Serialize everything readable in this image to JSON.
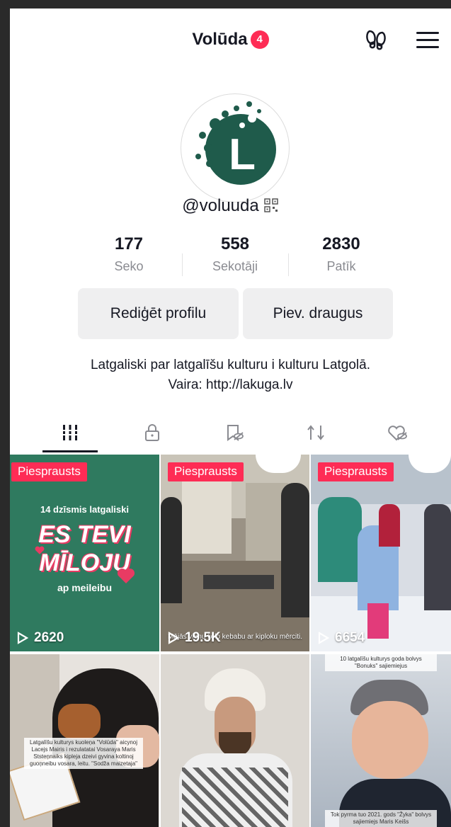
{
  "header": {
    "title": "Volūda",
    "badge": "4"
  },
  "profile": {
    "handle": "@voluuda",
    "avatar_letter": "L"
  },
  "stats": [
    {
      "value": "177",
      "label": "Seko"
    },
    {
      "value": "558",
      "label": "Sekotāji"
    },
    {
      "value": "2830",
      "label": "Patīk"
    }
  ],
  "buttons": {
    "edit": "Rediģēt profilu",
    "add_friends": "Piev. draugus"
  },
  "bio": {
    "line1": "Latgaliski par latgalīšu kulturu i kulturu Latgolā.",
    "line2": "Vaira: http://lakuga.lv"
  },
  "videos": [
    {
      "pinned": "Piesprausts",
      "views": "2620",
      "overlay_top": "14 dzīsmis latgaliski",
      "overlay_big1": "ES TEVI",
      "overlay_big2": "MĪLOJU",
      "overlay_bottom": "ap meileibu"
    },
    {
      "pinned": "Piesprausts",
      "views": "19.5K",
      "caption": "Mājās vienu lielo kebabu ar kiploku mērciti."
    },
    {
      "pinned": "Piesprausts",
      "views": "6654"
    },
    {
      "caption": "Latgalīšu kulturys kuoleņa \"Volūda\" aicynoj Lacejs Mairis i rezulatatai Vosaraya Maris Ststeņnaiks kipleja dzeivi gyvina koltinoj guoņneibu vosara, leitu. \"Sodža maizetaja\""
    },
    {},
    {
      "caption_top": "10 latgalīšu kulturys goda bolvys \"Bonuks\" sajiemiejus",
      "caption_bottom": "Tok pyrma tuo 2021. gods \"Žyka\" bolvys sajiemiejs Maris Keišs"
    }
  ],
  "colors": {
    "accent": "#fe2c55",
    "brand_green": "#1f5b4b",
    "text": "#161823",
    "muted": "#8a8b91"
  }
}
